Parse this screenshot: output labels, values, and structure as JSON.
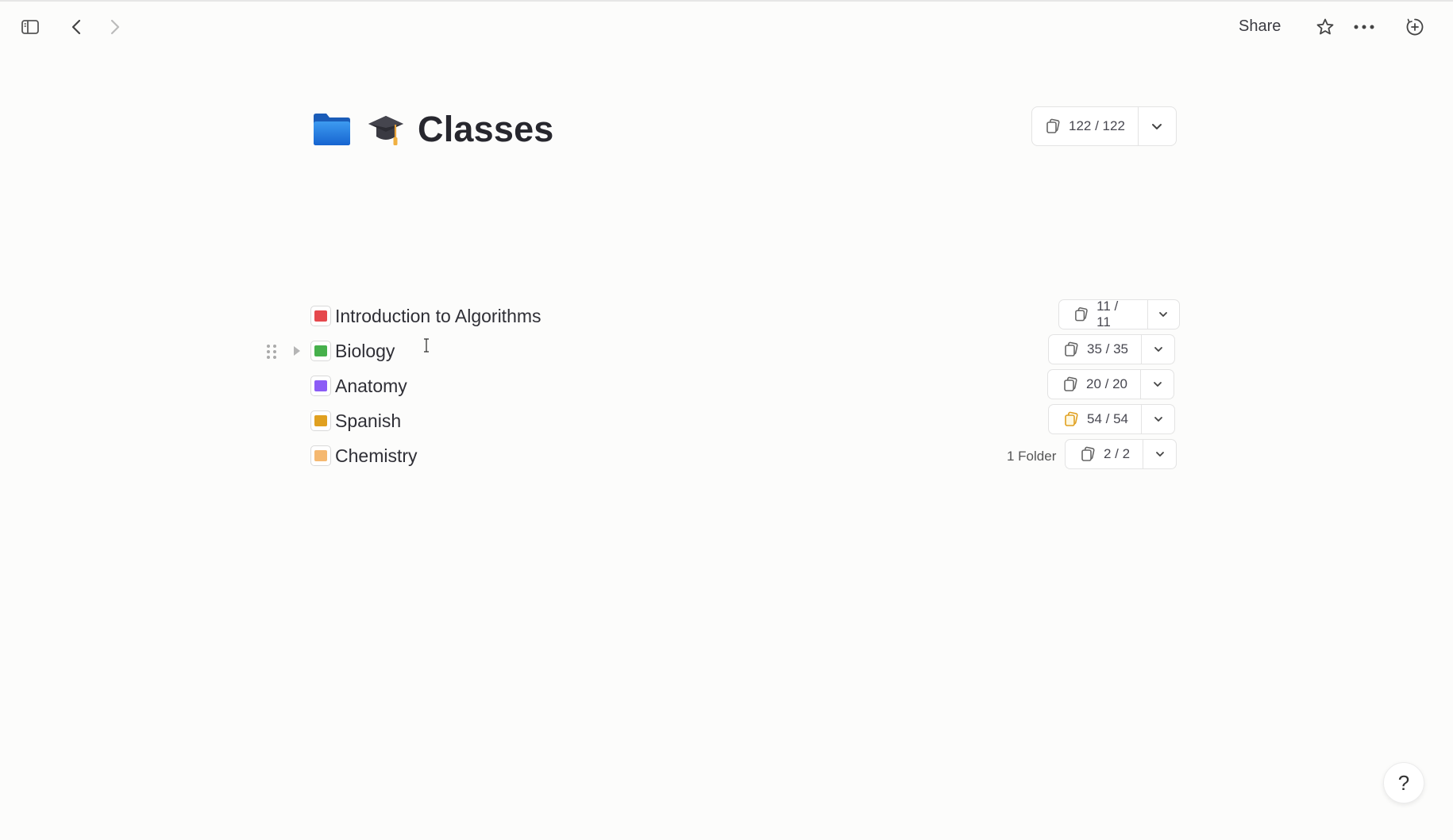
{
  "topbar": {
    "share_label": "Share",
    "icons": [
      "sidebar-toggle-icon",
      "back-arrow-icon",
      "forward-arrow-icon",
      "star-icon",
      "more-icon",
      "new-item-icon"
    ]
  },
  "page": {
    "title": "Classes",
    "count": "122 / 122"
  },
  "folders": [
    {
      "name": "Introduction to Algorithms",
      "count": "11 / 11",
      "color": "#e5484d",
      "meta": ""
    },
    {
      "name": "Biology",
      "count": "35 / 35",
      "color": "#46b04c",
      "meta": ""
    },
    {
      "name": "Anatomy",
      "count": "20 / 20",
      "color": "#8b5cf6",
      "meta": ""
    },
    {
      "name": "Spanish",
      "count": "54 / 54",
      "color": "#e0a020",
      "meta": ""
    },
    {
      "name": "Chemistry",
      "count": "2 / 2",
      "color": "#f5b870",
      "meta": "1 Folder"
    }
  ],
  "help_label": "?"
}
